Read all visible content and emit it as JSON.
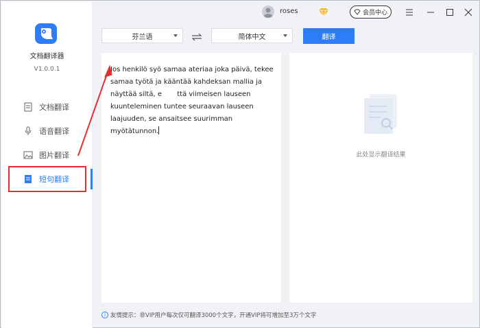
{
  "app": {
    "name": "文档翻译器",
    "version": "V1.0.0.1"
  },
  "sidebar": {
    "items": [
      {
        "label": "文档翻译",
        "icon": "document-icon",
        "active": false
      },
      {
        "label": "语音翻译",
        "icon": "microphone-icon",
        "active": false
      },
      {
        "label": "图片翻译",
        "icon": "image-icon",
        "active": false
      },
      {
        "label": "短句翻译",
        "icon": "text-icon",
        "active": true
      }
    ]
  },
  "topbar": {
    "user_name": "roses",
    "member_label": "会员中心"
  },
  "languages": {
    "source": "芬兰语",
    "target": "简体中文"
  },
  "translate_button": "翻译",
  "source_text": {
    "lines": [
      "Jos henkilö syö samaa ateriaa joka päivä, tekee",
      "samaa työtä ja kääntää kahdeksan mallia ja",
      "näyttää siltä, e       ttä viimeisen lauseen",
      "kuunteleminen tuntee seuraavan lauseen",
      "laajuuden, se ansaitsee suurimman myötätunnon."
    ]
  },
  "result": {
    "placeholder": "此处显示翻译结果"
  },
  "footer": {
    "tip": "友情提示：非VIP用户每次仅可翻译3000个文字，开通VIP将可增加至3万个文字"
  },
  "colors": {
    "accent": "#2f7df6",
    "annotation": "#e52e2e",
    "background": "#f0f2f5"
  }
}
